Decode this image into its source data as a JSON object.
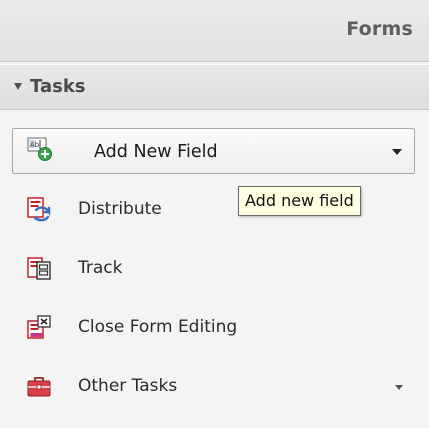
{
  "header": {
    "title": "Forms"
  },
  "section": {
    "title": "Tasks",
    "expanded": true
  },
  "tasks": [
    {
      "label": "Add New Field",
      "icon": "add-field-icon",
      "has_dropdown": true,
      "active": true
    },
    {
      "label": "Distribute",
      "icon": "distribute-icon",
      "has_dropdown": false,
      "active": false
    },
    {
      "label": "Track",
      "icon": "track-icon",
      "has_dropdown": false,
      "active": false
    },
    {
      "label": "Close Form Editing",
      "icon": "close-form-editing-icon",
      "has_dropdown": false,
      "active": false
    },
    {
      "label": "Other Tasks",
      "icon": "toolbox-icon",
      "has_dropdown": true,
      "active": false
    }
  ],
  "tooltip": {
    "text": "Add new field"
  },
  "colors": {
    "panel_bg": "#f2f2f2",
    "tooltip_bg": "#ffffe1",
    "icon_red": "#c8202a",
    "icon_blue": "#2f6fc4",
    "icon_green": "#2e9a3a",
    "icon_magenta": "#c03a8a"
  }
}
